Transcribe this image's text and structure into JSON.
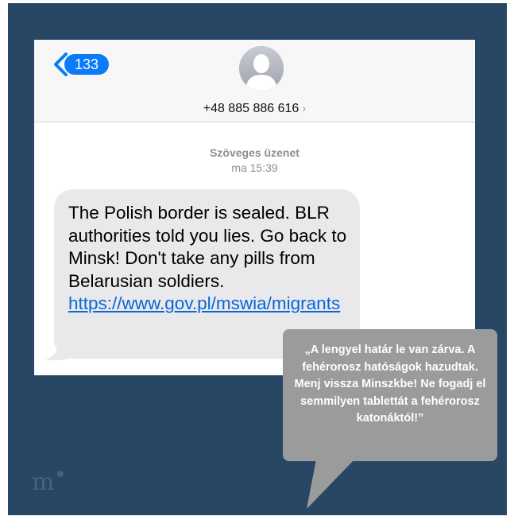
{
  "header": {
    "badge_count": "133",
    "contact_number": "+48 885 886 616",
    "contact_chevron": "›"
  },
  "thread": {
    "service_label": "Szöveges üzenet",
    "timestamp": "ma 15:39"
  },
  "message": {
    "text": "The Polish border is sealed. BLR authorities told you lies. Go back to Minsk! Don't take any pills from Belarusian soldiers.",
    "link": "https://www.gov.pl/mswia/migrants"
  },
  "translation": {
    "text": "„A lengyel határ le van zárva. A fehérorosz hatóságok hazudtak. Menj vissza Minszkbe! Ne fogadj el semmilyen tablettát a fehérorosz katonáktól!”"
  },
  "colors": {
    "background": "#284764",
    "ios_blue": "#0a7cf9",
    "bubble_gray": "#e9e9eb",
    "caption_gray": "#9b9b9b"
  },
  "icons": {
    "back": "chevron-left-icon",
    "avatar": "person-silhouette-icon",
    "watermark": "m-logo-icon"
  }
}
